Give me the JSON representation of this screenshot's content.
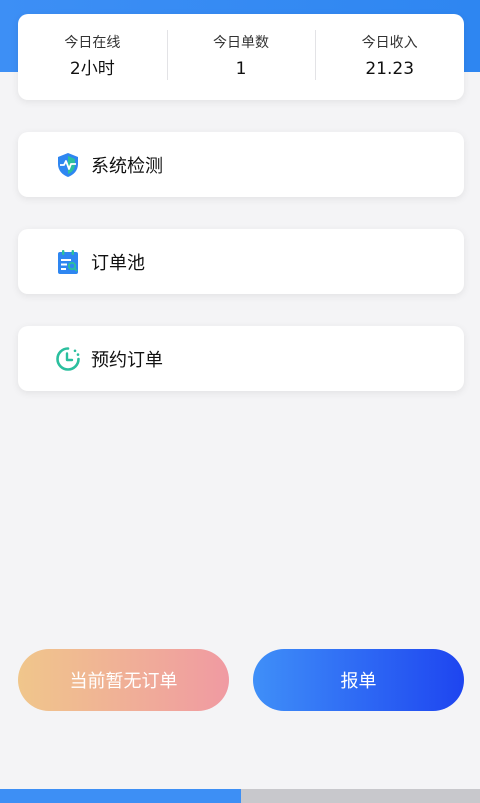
{
  "stats": [
    {
      "label": "今日在线",
      "value": "2小时"
    },
    {
      "label": "今日单数",
      "value": "1"
    },
    {
      "label": "今日收入",
      "value": "21.23"
    }
  ],
  "menu": [
    {
      "label": "系统检测",
      "icon": "shield-pulse-icon"
    },
    {
      "label": "订单池",
      "icon": "order-pool-icon"
    },
    {
      "label": "预约订单",
      "icon": "clock-icon"
    }
  ],
  "buttons": {
    "status_label": "当前暂无订单",
    "report_label": "报单"
  },
  "colors": {
    "brand_blue": "#2e86f1",
    "teal": "#2bbf9e",
    "status_gradient_start": "#f0c68b",
    "status_gradient_end": "#f09aa2",
    "report_gradient_start": "#3f8ff8",
    "report_gradient_end": "#1e45f0"
  }
}
